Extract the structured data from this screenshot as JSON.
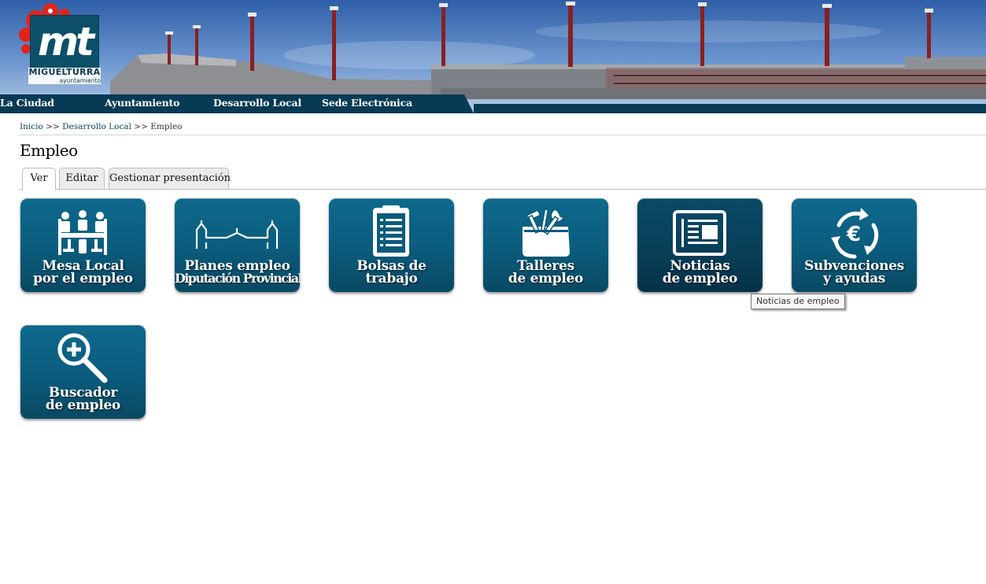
{
  "header": {
    "logo_mark": "mt",
    "logo_name": "MIGUELTURRA",
    "logo_sub": "ayuntamiento"
  },
  "nav": {
    "items": [
      {
        "label": "La Ciudad"
      },
      {
        "label": "Ayuntamiento"
      },
      {
        "label": "Desarrollo Local"
      },
      {
        "label": "Sede Electrónica"
      }
    ]
  },
  "breadcrumb": {
    "home": "Inicio",
    "sep1": ">>",
    "section": "Desarrollo Local",
    "sep2": ">>",
    "current": "Empleo"
  },
  "page": {
    "title": "Empleo"
  },
  "tabs": [
    {
      "label": "Ver",
      "active": true
    },
    {
      "label": "Editar",
      "active": false
    },
    {
      "label": "Gestionar presentación",
      "active": false
    }
  ],
  "tiles": [
    {
      "line1": "Mesa Local",
      "line2": "por el empleo",
      "icon": "meeting-table-icon"
    },
    {
      "line1": "Planes empleo",
      "line2": "Diputación Provincial",
      "icon": "building-outline-icon"
    },
    {
      "line1": "Bolsas de",
      "line2": "trabajo",
      "icon": "clipboard-icon"
    },
    {
      "line1": "Talleres",
      "line2": "de empleo",
      "icon": "toolbox-icon"
    },
    {
      "line1": "Noticias",
      "line2": "de empleo",
      "icon": "newspaper-icon"
    },
    {
      "line1": "Subvenciones",
      "line2": "y ayudas",
      "icon": "euro-cycle-icon"
    },
    {
      "line1": "Buscador",
      "line2": "de empleo",
      "icon": "magnifier-plus-icon"
    }
  ],
  "tooltip": {
    "text": "Noticias de empleo"
  },
  "colors": {
    "nav_bar": "#073a55",
    "tile": "#0b5b7c",
    "tile_hover": "#083f58",
    "logo_red": "#e2231a"
  }
}
